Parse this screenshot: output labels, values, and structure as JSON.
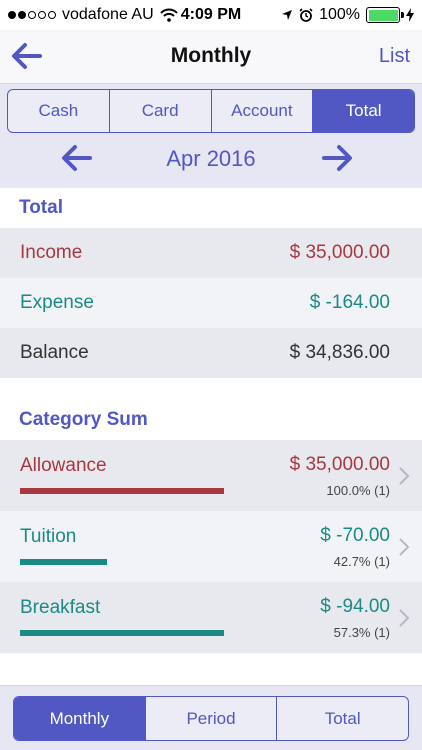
{
  "status_bar": {
    "carrier": "vodafone AU",
    "time": "4:09 PM",
    "battery": "100%",
    "signal_strength": 2
  },
  "nav": {
    "title": "Monthly",
    "right_label": "List",
    "back_icon": "arrow-left-icon"
  },
  "tabs": [
    {
      "label": "Cash",
      "active": false
    },
    {
      "label": "Card",
      "active": false
    },
    {
      "label": "Account",
      "active": false
    },
    {
      "label": "Total",
      "active": true
    }
  ],
  "month": {
    "label": "Apr 2016"
  },
  "total_section": {
    "header": "Total",
    "rows": [
      {
        "label": "Income",
        "amount": "$ 35,000.00",
        "color": "#a83840"
      },
      {
        "label": "Expense",
        "amount": "$ -164.00",
        "color": "#1a8a84"
      },
      {
        "label": "Balance",
        "amount": "$ 34,836.00",
        "color": "#333333"
      }
    ]
  },
  "category_section": {
    "header": "Category Sum",
    "items": [
      {
        "label": "Allowance",
        "amount": "$ 35,000.00",
        "percent": "100.0% (1)",
        "fraction": 1.0,
        "color": "#a83840"
      },
      {
        "label": "Tuition",
        "amount": "$ -70.00",
        "percent": "42.7% (1)",
        "fraction": 0.427,
        "color": "#1a8a84"
      },
      {
        "label": "Breakfast",
        "amount": "$ -94.00",
        "percent": "57.3% (1)",
        "fraction": 1.0,
        "color": "#1a8a84"
      }
    ]
  },
  "footer_tabs": [
    {
      "label": "Monthly",
      "active": true
    },
    {
      "label": "Period",
      "active": false
    },
    {
      "label": "Total",
      "active": false
    }
  ],
  "colors": {
    "accent": "#5158c4",
    "income": "#a83840",
    "expense": "#1a8a84"
  }
}
